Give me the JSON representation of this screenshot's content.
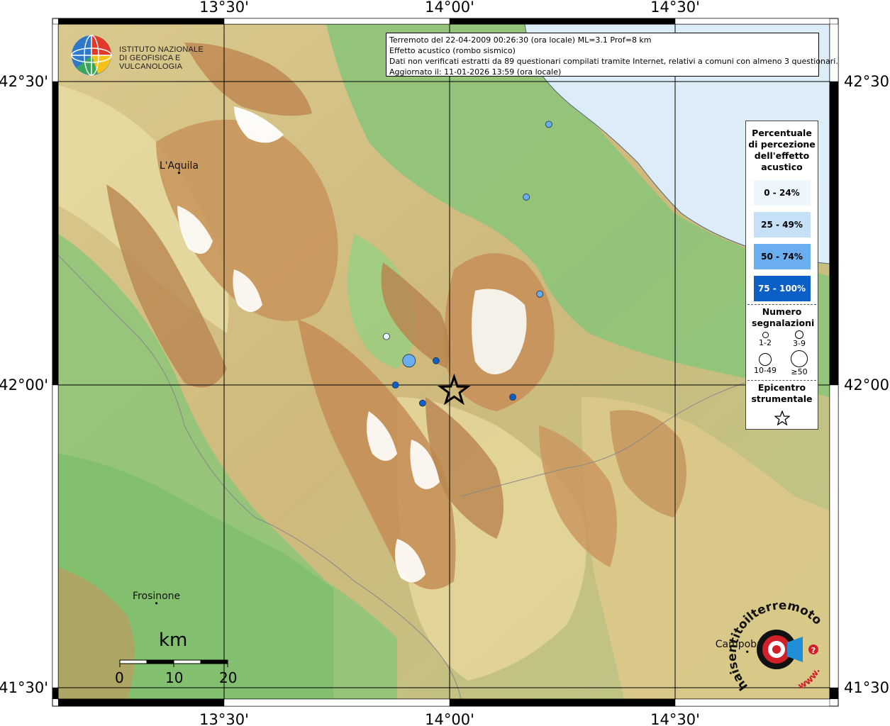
{
  "map": {
    "lon_labels": [
      "13°30'",
      "14°00'",
      "14°30'"
    ],
    "lat_labels": [
      "42°30'",
      "42°00'",
      "41°30'"
    ],
    "cities": [
      {
        "name": "L'Aquila",
        "lon": 13.4,
        "lat": 42.35
      },
      {
        "name": "Frosinone",
        "lon": 13.35,
        "lat": 41.64
      },
      {
        "name": "Campobasso",
        "lon": 14.66,
        "lat": 41.56
      }
    ],
    "epicenter": {
      "lon": 14.01,
      "lat": 41.99
    },
    "observations": [
      {
        "lon": 14.22,
        "lat": 42.43,
        "category": "50-74",
        "count": "1-2"
      },
      {
        "lon": 14.17,
        "lat": 42.31,
        "category": "50-74",
        "count": "1-2"
      },
      {
        "lon": 14.2,
        "lat": 42.15,
        "category": "50-74",
        "count": "1-2"
      },
      {
        "lon": 13.86,
        "lat": 42.08,
        "category": "0-24",
        "count": "1-2"
      },
      {
        "lon": 13.91,
        "lat": 42.04,
        "category": "50-74",
        "count": "3-9"
      },
      {
        "lon": 13.97,
        "lat": 42.04,
        "category": "75-100",
        "count": "1-2"
      },
      {
        "lon": 13.88,
        "lat": 42.0,
        "category": "75-100",
        "count": "1-2"
      },
      {
        "lon": 13.94,
        "lat": 41.97,
        "category": "75-100",
        "count": "1-2"
      },
      {
        "lon": 14.14,
        "lat": 41.98,
        "category": "75-100",
        "count": "1-2"
      }
    ]
  },
  "info": {
    "line1": "Terremoto del 22-04-2009 00:26:30 (ora locale) ML=3.1 Prof=8 km",
    "line2": "Effetto acustico (rombo sismico)",
    "line3": "Dati non verificati estratti da 89 questionari compilati tramite Internet, relativi a comuni con almeno 3 questionari.",
    "line4": "Aggiornato il: 11-01-2026 13:59 (ora locale)"
  },
  "logo": {
    "line1": "ISTITUTO NAZIONALE",
    "line2": "DI GEOFISICA E VULCANOLOGIA"
  },
  "legend": {
    "title": "Percentuale di percezione dell'effetto acustico",
    "categories": [
      {
        "label": "0 - 24%",
        "color": "#eef6fd"
      },
      {
        "label": "25 - 49%",
        "color": "#c6e0f8"
      },
      {
        "label": "50 - 74%",
        "color": "#6aaef0"
      },
      {
        "label": "75 - 100%",
        "color": "#0b5fc6"
      }
    ],
    "count_title": "Numero segnalazioni",
    "counts": [
      "1-2",
      "3-9",
      "10-49",
      "≥50"
    ],
    "epicenter_title": "Epicentro strumentale"
  },
  "scalebar": {
    "unit": "km",
    "ticks": [
      "0",
      "10",
      "20"
    ]
  },
  "watermark": {
    "text": "haisentitoilterremoto.it",
    "url_text": "www.",
    "brand_color": "#d0202a"
  },
  "colors": {
    "lowland": "#7fbf6e",
    "hills": "#e6d9a0",
    "mountains": "#c8945a",
    "peaks": "#ffffff",
    "sea": "#dcedf8"
  }
}
